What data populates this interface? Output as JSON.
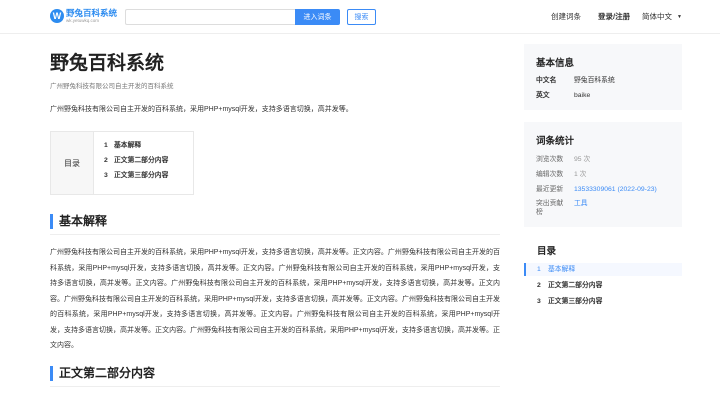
{
  "header": {
    "logo_mark": "●",
    "logo_title": "野兔百科系统",
    "logo_sub": "wk.yetuwkq.com",
    "search_placeholder": "",
    "enter_button": "进入词条",
    "search_button": "搜索",
    "create_entry": "创建词条",
    "login": "登录/注册",
    "language": "简体中文",
    "language_caret": "▼"
  },
  "article": {
    "title": "野兔百科系统",
    "subtitle": "广州野兔科技有限公司自主开发的百科系统",
    "intro": "广州野兔科技有限公司自主开发的百科系统，采用PHP+mysql开发，支持多语言切换，高并发等。",
    "toc_label": "目录",
    "toc": [
      {
        "num": "1",
        "label": "基本解释"
      },
      {
        "num": "2",
        "label": "正文第二部分内容"
      },
      {
        "num": "3",
        "label": "正文第三部分内容"
      }
    ],
    "section1_title": "基本解释",
    "section1_text": "广州野兔科技有限公司自主开发的百科系统，采用PHP+mysql开发，支持多语言切换，高并发等。正文内容。广州野兔科技有限公司自主开发的百科系统，采用PHP+mysql开发，支持多语言切换，高并发等。正文内容。广州野兔科技有限公司自主开发的百科系统，采用PHP+mysql开发，支持多语言切换，高并发等。正文内容。广州野兔科技有限公司自主开发的百科系统，采用PHP+mysql开发，支持多语言切换，高并发等。正文内容。广州野兔科技有限公司自主开发的百科系统，采用PHP+mysql开发，支持多语言切换，高并发等。正文内容。广州野兔科技有限公司自主开发的百科系统，采用PHP+mysql开发，支持多语言切换，高并发等。正文内容。广州野兔科技有限公司自主开发的百科系统，采用PHP+mysql开发，支持多语言切换，高并发等。正文内容。广州野兔科技有限公司自主开发的百科系统，采用PHP+mysql开发，支持多语言切换，高并发等。正文内容。",
    "section2_title": "正文第二部分内容"
  },
  "sidebar": {
    "basic_info": {
      "title": "基本信息",
      "rows": [
        {
          "key": "中文名",
          "value": "野兔百科系统"
        },
        {
          "key": "英文",
          "value": "baike"
        }
      ]
    },
    "stats": {
      "title": "词条统计",
      "views_key": "浏览次数",
      "views_val": "95 次",
      "edits_key": "编辑次数",
      "edits_val": "1 次",
      "updated_key": "最近更新",
      "updated_val": "13533309061 (2022-09-23)",
      "contrib_key": "突出贡献榜",
      "contrib_val": "工具"
    },
    "toc": {
      "title": "目录",
      "items": [
        {
          "num": "1",
          "label": "基本解释",
          "active": true
        },
        {
          "num": "2",
          "label": "正文第二部分内容"
        },
        {
          "num": "3",
          "label": "正文第三部分内容"
        }
      ]
    }
  },
  "colors": {
    "accent": "#3b8bf6",
    "card_bg": "#f7f8fa"
  }
}
